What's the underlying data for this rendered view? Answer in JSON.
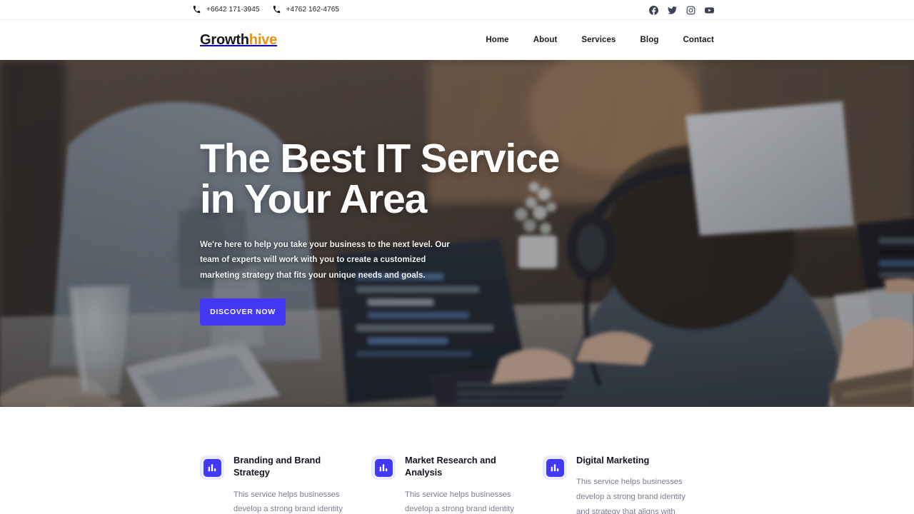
{
  "topbar": {
    "phones": [
      {
        "icon": "phone-icon",
        "number": "+6642 171-3945"
      },
      {
        "icon": "phone-icon",
        "number": "+4762 162-4765"
      }
    ],
    "socials": [
      {
        "name": "facebook-icon",
        "label": "Facebook"
      },
      {
        "name": "twitter-icon",
        "label": "Twitter"
      },
      {
        "name": "instagram-icon",
        "label": "Instagram"
      },
      {
        "name": "youtube-icon",
        "label": "YouTube"
      }
    ]
  },
  "header": {
    "logo_first": "Growth",
    "logo_second": "hive",
    "nav": [
      {
        "label": "Home"
      },
      {
        "label": "About"
      },
      {
        "label": "Services"
      },
      {
        "label": "Blog"
      },
      {
        "label": "Contact"
      }
    ]
  },
  "hero": {
    "heading_line1": "The Best IT Service",
    "heading_line2": "in Your Area",
    "paragraph": "We're here to help you take your business to the next level. Our team of experts will work with you to create a customized marketing strategy that fits your unique needs and goals.",
    "cta_label": "DISCOVER NOW",
    "background_description": "People working on laptops at a shared wooden table in a coworking space"
  },
  "services": {
    "cards": [
      {
        "icon": "bar-chart-icon",
        "title": "Branding and Brand Strategy",
        "description": "This service helps businesses develop a strong brand identity"
      },
      {
        "icon": "bar-chart-icon",
        "title": "Market Research and Analysis",
        "description": "This service helps businesses develop a strong brand identity"
      },
      {
        "icon": "bar-chart-icon",
        "title": "Digital Marketing",
        "description": "This service helps businesses develop a strong brand identity and strategy that aligns with"
      }
    ]
  },
  "colors": {
    "accent_blue": "#4338f5",
    "logo_orange": "#e8921a",
    "text_dark": "#15151f",
    "text_muted": "#7b7f8c",
    "icon_bg": "#eceaff"
  }
}
